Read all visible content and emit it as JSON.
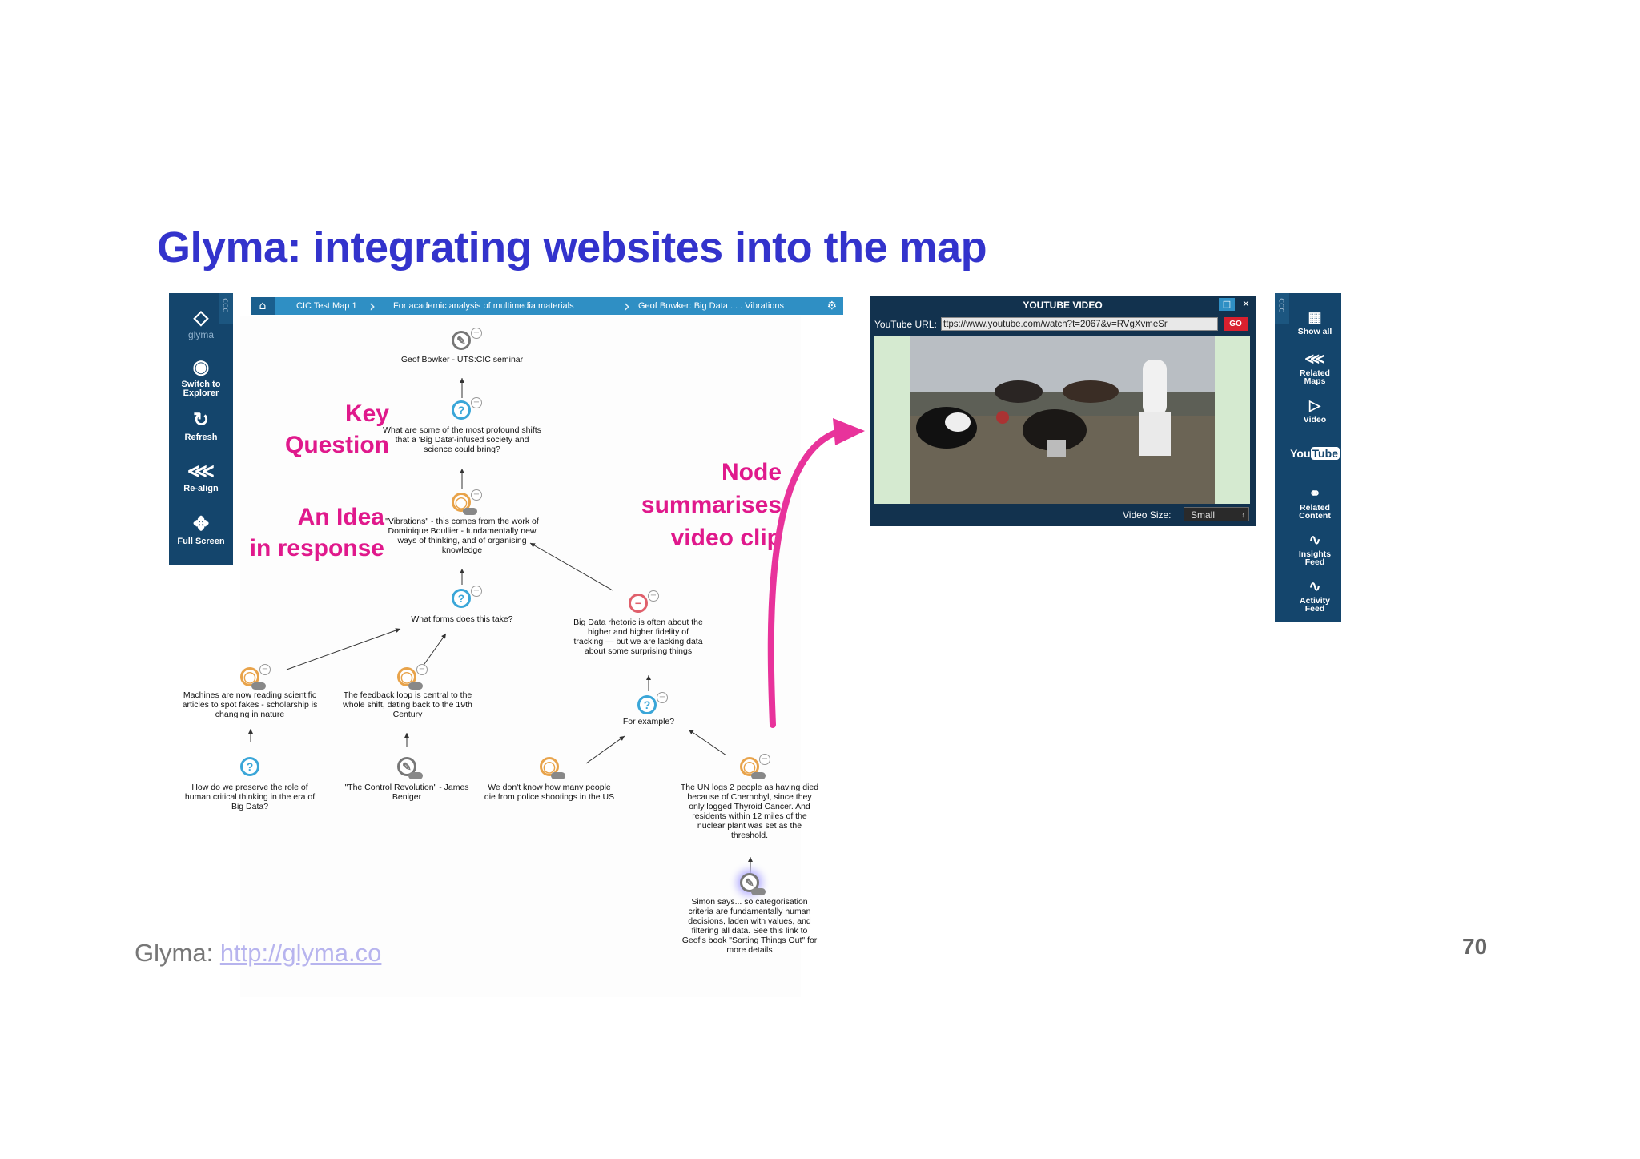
{
  "slide": {
    "title": "Glyma: integrating websites into the map",
    "footer_label": "Glyma:",
    "footer_link": "http://glyma.co",
    "page_number": "70"
  },
  "left_toolbar": {
    "logo": "glyma",
    "items": [
      {
        "label": "Switch to Explorer",
        "icon": "eye-icon"
      },
      {
        "label": "Refresh",
        "icon": "refresh-icon"
      },
      {
        "label": "Re-align",
        "icon": "share-icon"
      },
      {
        "label": "Full Screen",
        "icon": "fullscreen-icon"
      }
    ]
  },
  "breadcrumb": {
    "items": [
      "CIC Test Map 1",
      "For academic analysis of multimedia materials",
      "Geof Bowker: Big Data . . . Vibrations"
    ]
  },
  "map": {
    "nodes": {
      "root": "Geof Bowker - UTS:CIC seminar",
      "key_question": "What are some of the most profound shifts that a 'Big Data'-infused society and science could bring?",
      "idea_vibrations": "\"Vibrations\" - this comes from the work of Dominique Boullier - fundamentally new ways of thinking, and of organising knowledge",
      "q_forms": "What forms does this take?",
      "con_rhetoric": "Big Data rhetoric is often about the higher and higher fidelity of tracking — but we are lacking data about some surprising things",
      "idea_machines": "Machines are now reading scientific articles to spot fakes - scholarship is changing in nature",
      "idea_feedback": "The feedback loop is central to the whole shift, dating back to the 19th Century",
      "q_example": "For example?",
      "q_preserve": "How do we preserve the role of human critical thinking in the era of Big Data?",
      "note_control": "\"The Control Revolution\" - James Beniger",
      "idea_police": "We don't know how many people die from police shootings in the US",
      "idea_un": "The UN logs 2 people as having died because of Chernobyl, since they only logged Thyroid Cancer. And residents within 12 miles of the nuclear plant was set as the threshold.",
      "note_simon": "Simon says... so categorisation criteria are fundamentally human decisions, laden with values, and filtering all data. See this link to Geof's book \"Sorting Things Out\" for more details"
    }
  },
  "annotations": {
    "key_question": [
      "Key",
      "Question"
    ],
    "idea": [
      "An Idea",
      "in response"
    ],
    "node_summary": [
      "Node",
      "summarises",
      "video clip"
    ]
  },
  "youtube": {
    "title": "YOUTUBE VIDEO",
    "url_label": "YouTube URL:",
    "url_value": "ttps://www.youtube.com/watch?t=2067&v=RVgXvmeSr",
    "go_label": "GO",
    "size_label": "Video Size:",
    "size_value": "Small"
  },
  "right_toolbar": {
    "items": [
      {
        "label": "Show all",
        "icon": "grid-icon"
      },
      {
        "label": "Related Maps",
        "icon": "share-icon"
      },
      {
        "label": "Video",
        "icon": "video-icon"
      },
      {
        "label": "YouTube",
        "icon": "youtube-icon"
      },
      {
        "label": "Related Content",
        "icon": "paperclip-icon"
      },
      {
        "label": "Insights Feed",
        "icon": "rss-icon"
      },
      {
        "label": "Activity Feed",
        "icon": "rss-icon"
      }
    ]
  },
  "colors": {
    "title": "#3333cc",
    "annotation": "#e0198c",
    "toolbar": "#14456c",
    "breadcrumb": "#2f8fc4",
    "question": "#3aa6d8",
    "idea": "#e8a34a",
    "con": "#e0606c"
  }
}
